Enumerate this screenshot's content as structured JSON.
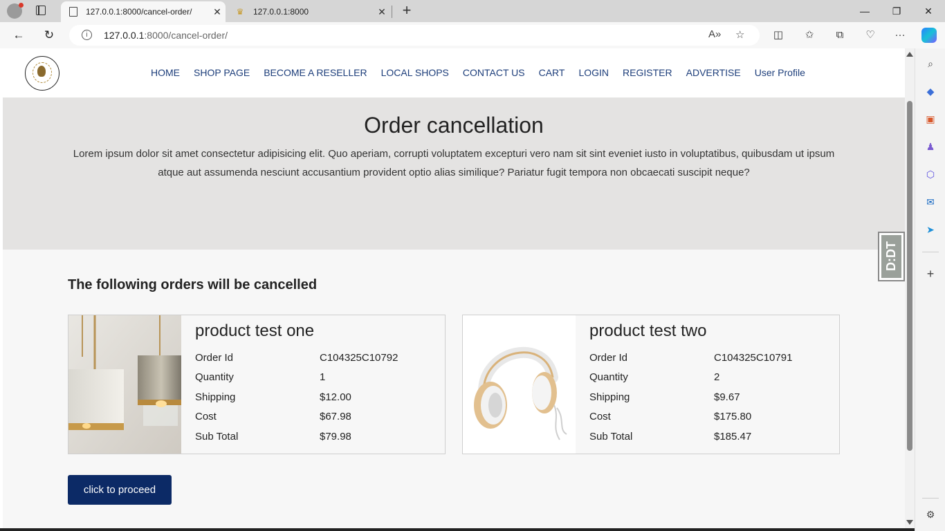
{
  "browser": {
    "tabs": [
      {
        "title": "127.0.0.1:8000/cancel-order/",
        "active": true
      },
      {
        "title": "127.0.0.1:8000",
        "active": false
      }
    ],
    "url_host": "127.0.0.1",
    "url_rest": ":8000/cancel-order/"
  },
  "site": {
    "nav": [
      "HOME",
      "SHOP PAGE",
      "BECOME A RESELLER",
      "LOCAL SHOPS",
      "CONTACT US",
      "CART",
      "LOGIN",
      "REGISTER",
      "ADVERTISE",
      "User Profile"
    ],
    "colors": {
      "nav_link": "#1c3d7a",
      "button_bg": "#0c2a66",
      "hero_bg": "#e4e3e2"
    }
  },
  "hero": {
    "title": "Order cancellation",
    "text": "Lorem ipsum dolor sit amet consectetur adipisicing elit. Quo aperiam, corrupti voluptatem excepturi vero nam sit sint eveniet iusto in voluptatibus, quibusdam ut ipsum atque aut assumenda nesciunt accusantium provident optio alias similique? Pariatur fugit tempora non obcaecati suscipit neque?"
  },
  "orders": {
    "section_title": "The following orders will be cancelled",
    "labels": {
      "order_id": "Order Id",
      "quantity": "Quantity",
      "shipping": "Shipping",
      "cost": "Cost",
      "sub_total": "Sub Total"
    },
    "items": [
      {
        "name": "product test one",
        "image": "pendant-lamps",
        "order_id": "C104325C10792",
        "quantity": "1",
        "shipping": "$12.00",
        "cost": "$67.98",
        "sub_total": "$79.98"
      },
      {
        "name": "product test two",
        "image": "headphones",
        "order_id": "C104325C10791",
        "quantity": "2",
        "shipping": "$9.67",
        "cost": "$175.80",
        "sub_total": "$185.47"
      }
    ],
    "proceed_label": "click to proceed"
  },
  "widget": {
    "label": "D:DT"
  }
}
